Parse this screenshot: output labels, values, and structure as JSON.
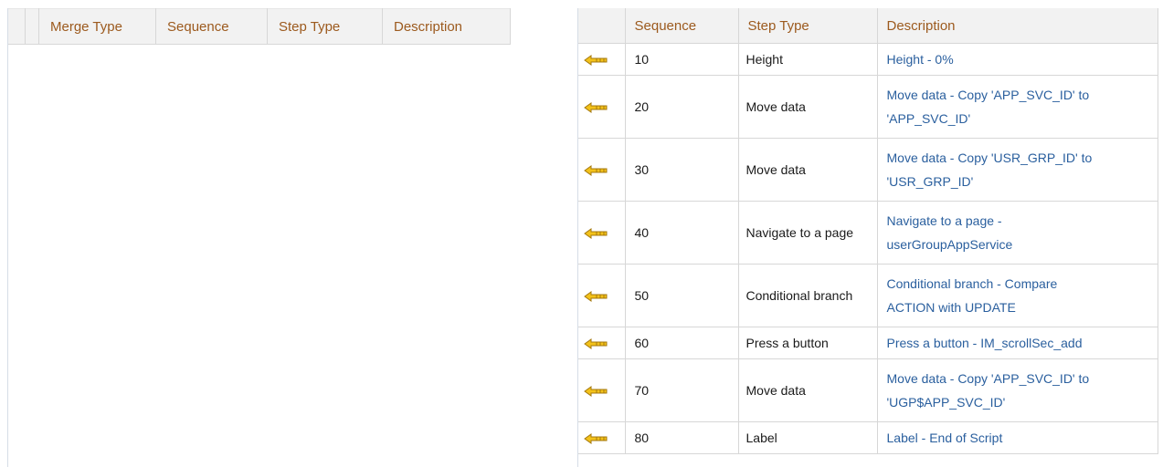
{
  "left_grid": {
    "columns": [
      "Merge Type",
      "Sequence",
      "Step Type",
      "Description"
    ]
  },
  "right_grid": {
    "columns": [
      "Sequence",
      "Step Type",
      "Description"
    ],
    "rows": [
      {
        "sequence": "10",
        "step_type": "Height",
        "description_lines": [
          "Height - 0%"
        ]
      },
      {
        "sequence": "20",
        "step_type": "Move data",
        "description_lines": [
          "Move data - Copy 'APP_SVC_ID' to",
          "'APP_SVC_ID'"
        ]
      },
      {
        "sequence": "30",
        "step_type": "Move data",
        "description_lines": [
          "Move data - Copy 'USR_GRP_ID' to",
          "'USR_GRP_ID'"
        ]
      },
      {
        "sequence": "40",
        "step_type": "Navigate to a page",
        "description_lines": [
          "Navigate to a page -",
          "userGroupAppService"
        ]
      },
      {
        "sequence": "50",
        "step_type": "Conditional branch",
        "description_lines": [
          "Conditional branch - Compare",
          "ACTION with UPDATE"
        ]
      },
      {
        "sequence": "60",
        "step_type": "Press a button",
        "description_lines": [
          "Press a button - IM_scrollSec_add"
        ]
      },
      {
        "sequence": "70",
        "step_type": "Move data",
        "description_lines": [
          "Move data - Copy 'APP_SVC_ID' to",
          "'UGP$APP_SVC_ID'"
        ]
      },
      {
        "sequence": "80",
        "step_type": "Label",
        "description_lines": [
          "Label - End of Script"
        ]
      }
    ]
  },
  "icons": {
    "row_arrow": "move-left-arrow-icon"
  },
  "colors": {
    "header_text": "#9c5a1e",
    "description_text": "#2a5f9e",
    "arrow_fill": "#f3c21a"
  }
}
